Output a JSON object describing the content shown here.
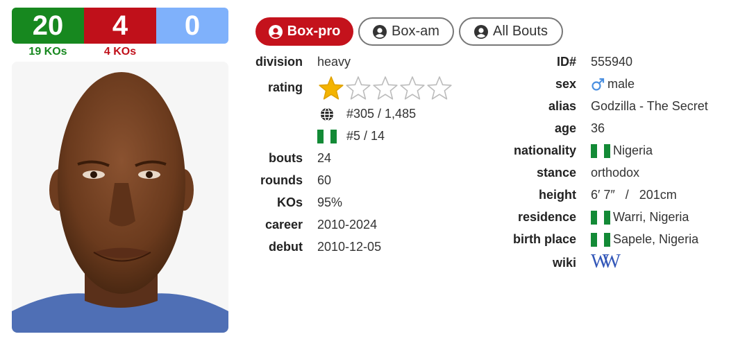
{
  "record": {
    "wins": "20",
    "losses": "4",
    "draws": "0",
    "wins_ko": "19 KOs",
    "losses_ko": "4 KOs",
    "colors": {
      "win": "#17881f",
      "loss": "#c0101a",
      "draw": "#7fb1fb"
    }
  },
  "tabs": [
    {
      "label": "Box-pro",
      "active": true
    },
    {
      "label": "Box-am",
      "active": false
    },
    {
      "label": "All Bouts",
      "active": false
    }
  ],
  "left": {
    "division": {
      "label": "division",
      "value": "heavy"
    },
    "rating": {
      "label": "rating",
      "stars_filled": 1,
      "stars_total": 5
    },
    "world_rank": {
      "icon": "globe-icon",
      "value": "#305 / 1,485"
    },
    "country_rank": {
      "icon": "nigeria-flag-icon",
      "value": "#5 / 14"
    },
    "bouts": {
      "label": "bouts",
      "value": "24"
    },
    "rounds": {
      "label": "rounds",
      "value": "60"
    },
    "kos": {
      "label": "KOs",
      "value": "95%"
    },
    "career": {
      "label": "career",
      "value": "2010-2024"
    },
    "debut": {
      "label": "debut",
      "value": "2010-12-05"
    }
  },
  "right": {
    "id": {
      "label": "ID#",
      "value": "555940"
    },
    "sex": {
      "label": "sex",
      "value": "male",
      "icon": "male-symbol-icon"
    },
    "alias": {
      "label": "alias",
      "value": "Godzilla - The Secret"
    },
    "age": {
      "label": "age",
      "value": "36"
    },
    "nationality": {
      "label": "nationality",
      "value": "Nigeria"
    },
    "stance": {
      "label": "stance",
      "value": "orthodox"
    },
    "height": {
      "label": "height",
      "value": "6′ 7″   /   201cm"
    },
    "residence": {
      "label": "residence",
      "value": "Warri, Nigeria"
    },
    "birth_place": {
      "label": "birth place",
      "value": "Sapele, Nigeria"
    },
    "wiki": {
      "label": "wiki",
      "icon": "wikipedia-icon",
      "value": "W"
    }
  }
}
